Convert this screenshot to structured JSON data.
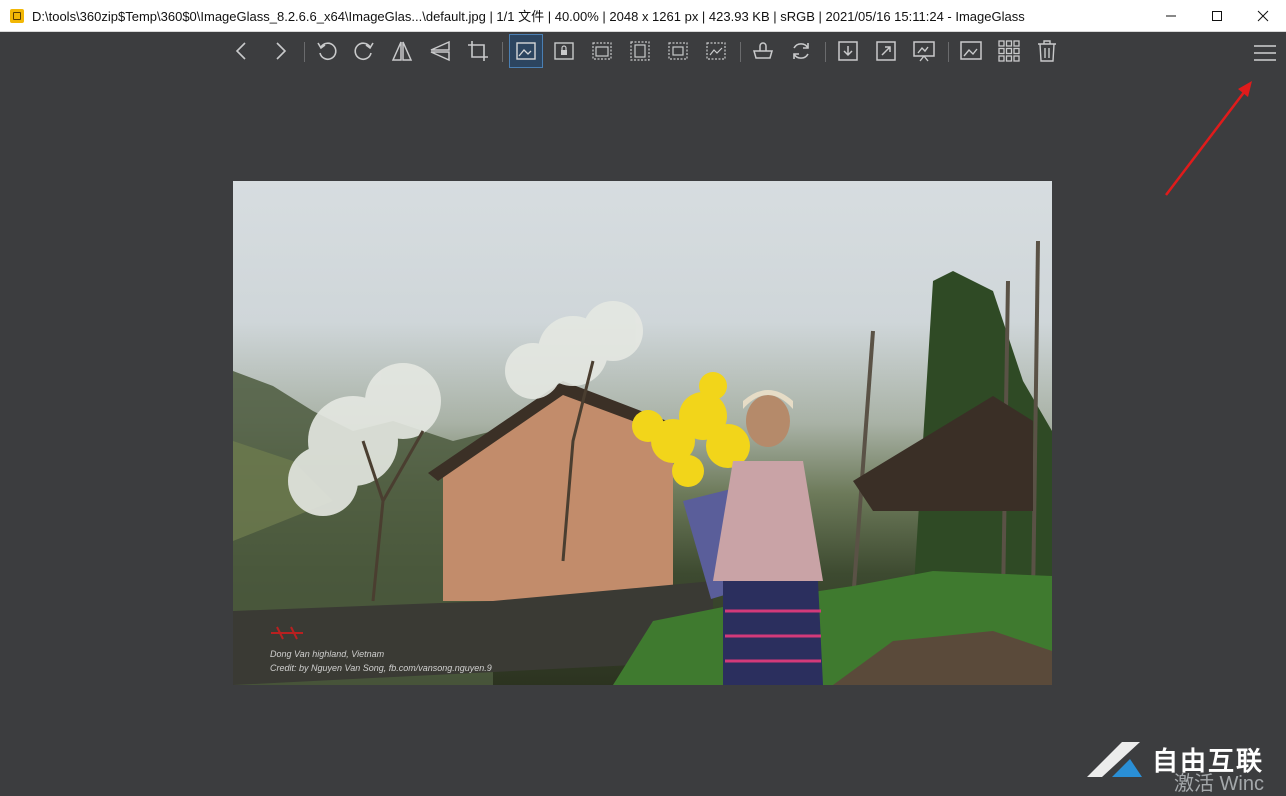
{
  "window": {
    "title": "D:\\tools\\360zip$Temp\\360$0\\ImageGlass_8.2.6.6_x64\\ImageGlas...\\default.jpg  |  1/1 文件  |  40.00%  |  2048 x 1261 px  |  423.93 KB  |  sRGB  |  2021/05/16 15:11:24  - ImageGlass"
  },
  "toolbar": {
    "buttons": [
      {
        "name": "previous-image",
        "icon": "chevron-left-icon"
      },
      {
        "name": "next-image",
        "icon": "chevron-right-icon"
      },
      {
        "name": "rotate-left",
        "icon": "rotate-left-icon"
      },
      {
        "name": "rotate-right",
        "icon": "rotate-right-icon"
      },
      {
        "name": "flip-horizontal",
        "icon": "flip-horizontal-icon"
      },
      {
        "name": "flip-vertical",
        "icon": "flip-vertical-icon"
      },
      {
        "name": "crop",
        "icon": "crop-icon"
      },
      {
        "name": "auto-zoom",
        "icon": "auto-zoom-icon",
        "active": true
      },
      {
        "name": "lock-zoom",
        "icon": "lock-zoom-icon"
      },
      {
        "name": "scale-to-width",
        "icon": "scale-width-icon"
      },
      {
        "name": "scale-to-height",
        "icon": "scale-height-icon"
      },
      {
        "name": "scale-to-fit",
        "icon": "scale-fit-icon"
      },
      {
        "name": "scale-to-fill",
        "icon": "scale-fill-icon"
      },
      {
        "name": "open-with",
        "icon": "open-with-icon"
      },
      {
        "name": "refresh",
        "icon": "refresh-icon"
      },
      {
        "name": "goto-image",
        "icon": "goto-icon"
      },
      {
        "name": "fullscreen",
        "icon": "fullscreen-icon"
      },
      {
        "name": "slideshow",
        "icon": "slideshow-icon"
      },
      {
        "name": "set-wallpaper",
        "icon": "wallpaper-icon"
      },
      {
        "name": "thumbnails",
        "icon": "thumbnails-icon"
      },
      {
        "name": "delete",
        "icon": "trash-icon"
      }
    ],
    "menu_icon": "hamburger-menu-icon"
  },
  "photo": {
    "caption_line1": "Dong Van highland, Vietnam",
    "caption_line2": "Credit: by Nguyen Van Song, fb.com/vansong.nguyen.9"
  },
  "watermark": {
    "brand": "自由互联",
    "sub": "激活 Winc"
  },
  "colors": {
    "background": "#3c3d3f",
    "active_button": "#2c4560",
    "annotation_arrow": "#e01b1b"
  }
}
